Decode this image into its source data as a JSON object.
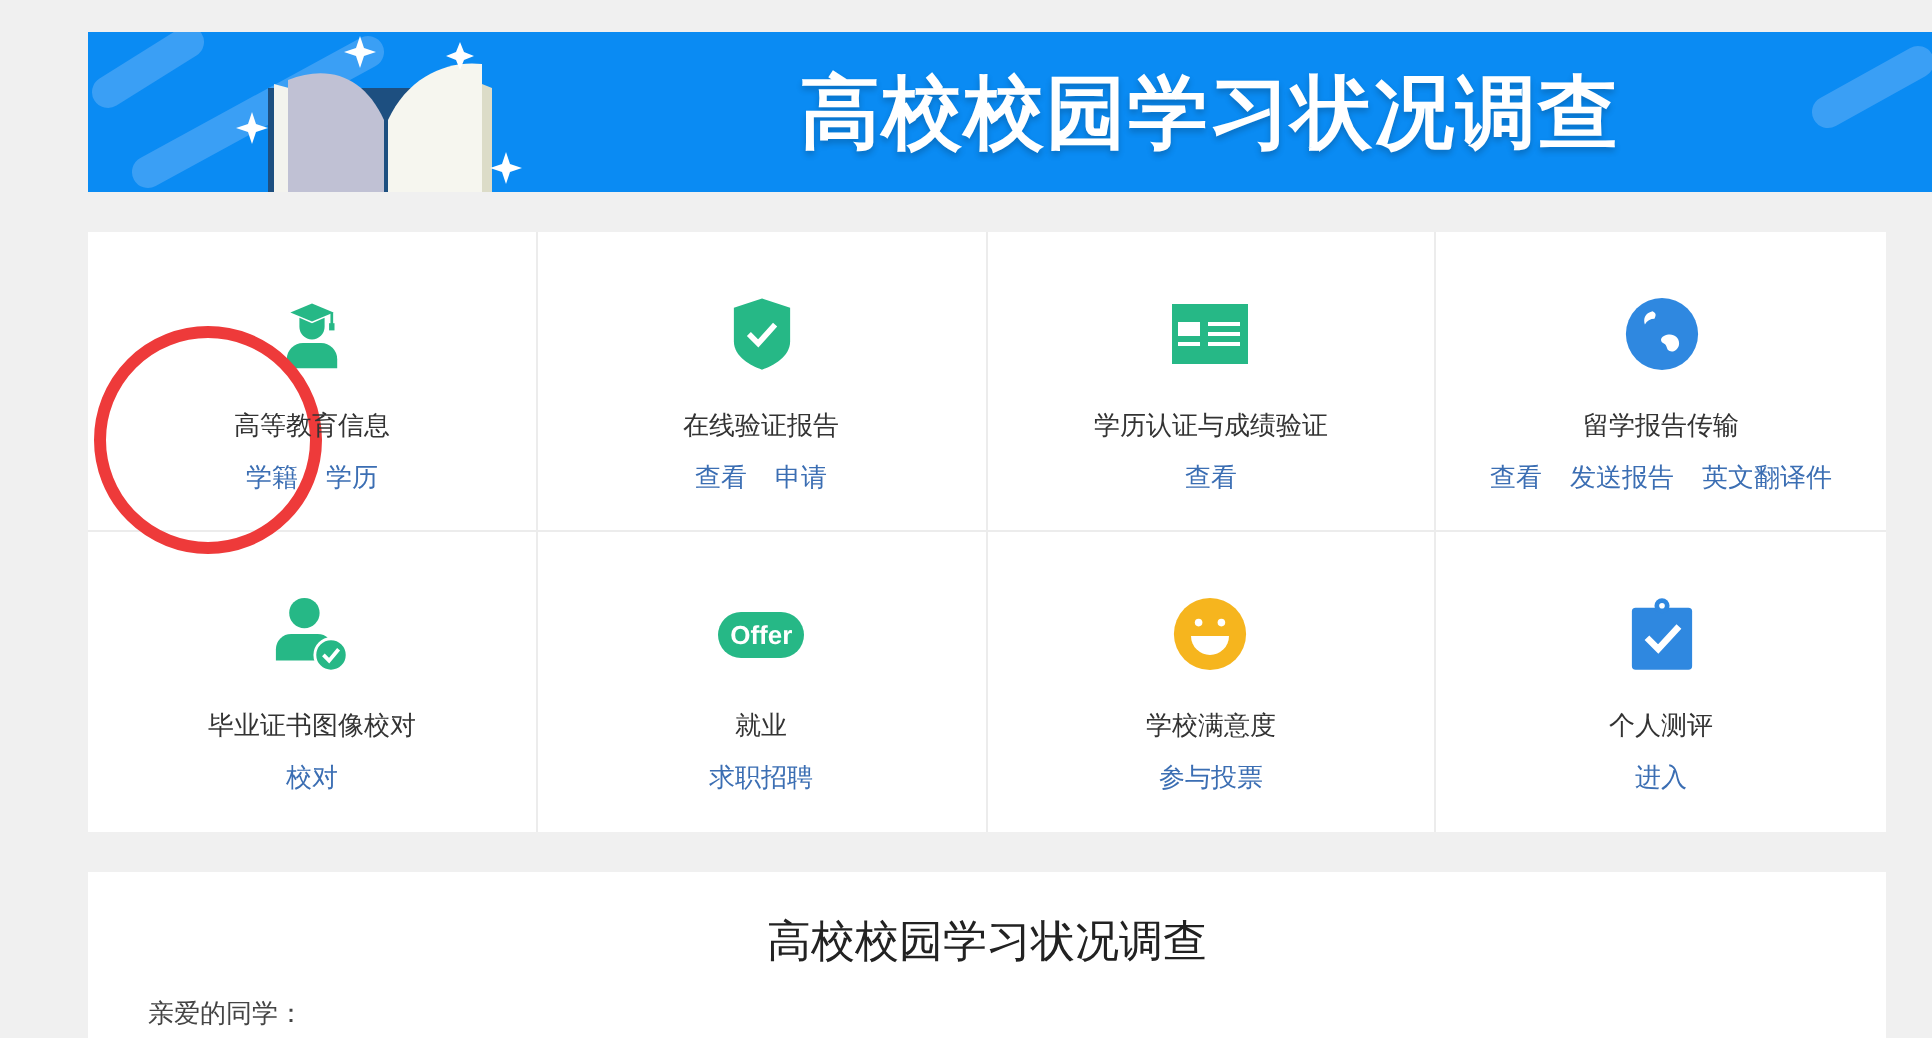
{
  "banner": {
    "title": "高校校园学习状况调查"
  },
  "services": [
    {
      "kind": "graduate",
      "title": "高等教育信息",
      "links": [
        "学籍",
        "学历"
      ]
    },
    {
      "kind": "shield",
      "title": "在线验证报告",
      "links": [
        "查看",
        "申请"
      ]
    },
    {
      "kind": "card",
      "title": "学历认证与成绩验证",
      "links": [
        "查看"
      ]
    },
    {
      "kind": "globe",
      "title": "留学报告传输",
      "links": [
        "查看",
        "发送报告",
        "英文翻译件"
      ]
    },
    {
      "kind": "user-check",
      "title": "毕业证书图像校对",
      "links": [
        "校对"
      ]
    },
    {
      "kind": "offer",
      "badge": "Offer",
      "title": "就业",
      "links": [
        "求职招聘"
      ]
    },
    {
      "kind": "smile",
      "title": "学校满意度",
      "links": [
        "参与投票"
      ]
    },
    {
      "kind": "clipboard",
      "title": "个人测评",
      "links": [
        "进入"
      ]
    }
  ],
  "survey": {
    "title": "高校校园学习状况调查",
    "greeting": "亲爱的同学："
  }
}
